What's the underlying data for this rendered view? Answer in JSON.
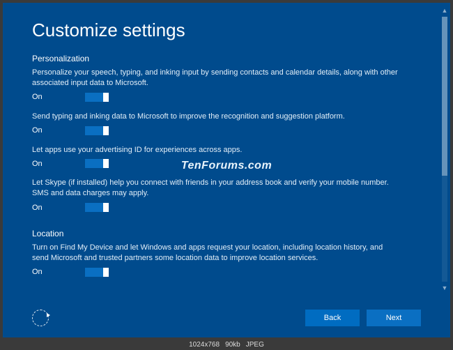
{
  "title": "Customize settings",
  "watermark": "TenForums.com",
  "sections": {
    "personalization": {
      "header": "Personalization",
      "items": [
        {
          "desc": "Personalize your speech, typing, and inking input by sending contacts and calendar details, along with other associated input data to Microsoft.",
          "state": "On"
        },
        {
          "desc": "Send typing and inking data to Microsoft to improve the recognition and suggestion platform.",
          "state": "On"
        },
        {
          "desc": "Let apps use your advertising ID for experiences across apps.",
          "state": "On"
        },
        {
          "desc": "Let Skype (if installed) help you connect with friends in your address book and verify your mobile number. SMS and data charges may apply.",
          "state": "On"
        }
      ]
    },
    "location": {
      "header": "Location",
      "items": [
        {
          "desc": "Turn on Find My Device and let Windows and apps request your location, including location history, and send Microsoft and trusted partners some location data to improve location services.",
          "state": "On"
        }
      ]
    }
  },
  "buttons": {
    "back": "Back",
    "next": "Next"
  },
  "status": {
    "resolution": "1024x768",
    "size": "90kb",
    "format": "JPEG"
  }
}
